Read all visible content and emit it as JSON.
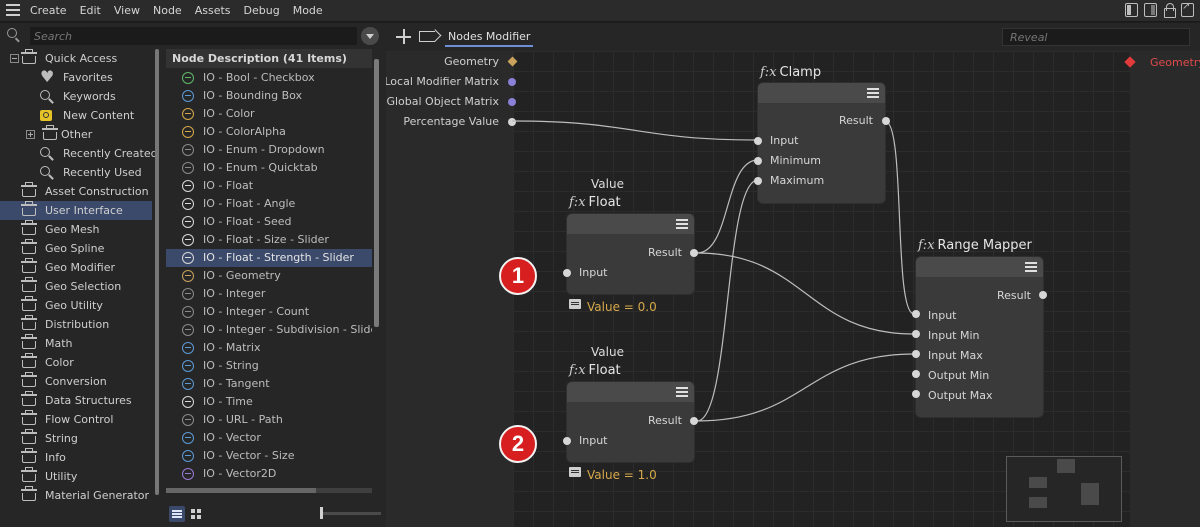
{
  "menubar": {
    "items": [
      "Create",
      "Edit",
      "View",
      "Node",
      "Assets",
      "Debug",
      "Mode"
    ]
  },
  "browser": {
    "search_placeholder": "Search",
    "tree": [
      {
        "label": "Quick Access",
        "icon": "drawer-icon",
        "expander": "minus"
      },
      {
        "label": "Favorites",
        "icon": "heart-icon"
      },
      {
        "label": "Keywords",
        "icon": "magnifier-icon"
      },
      {
        "label": "New Content",
        "icon": "new-content-icon"
      },
      {
        "label": "Other",
        "icon": "drawer-icon",
        "expander": "plus"
      },
      {
        "label": "Recently Created",
        "icon": "magnifier-icon"
      },
      {
        "label": "Recently Used",
        "icon": "magnifier-icon"
      },
      {
        "label": "Asset Construction",
        "icon": "drawer-icon"
      },
      {
        "label": "User Interface",
        "icon": "drawer-icon",
        "selected": true
      },
      {
        "label": "Geo Mesh",
        "icon": "drawer-icon"
      },
      {
        "label": "Geo Spline",
        "icon": "drawer-icon"
      },
      {
        "label": "Geo Modifier",
        "icon": "drawer-icon"
      },
      {
        "label": "Geo Selection",
        "icon": "drawer-icon"
      },
      {
        "label": "Geo Utility",
        "icon": "drawer-icon"
      },
      {
        "label": "Distribution",
        "icon": "drawer-icon"
      },
      {
        "label": "Math",
        "icon": "drawer-icon"
      },
      {
        "label": "Color",
        "icon": "drawer-icon"
      },
      {
        "label": "Conversion",
        "icon": "drawer-icon"
      },
      {
        "label": "Data Structures",
        "icon": "drawer-icon"
      },
      {
        "label": "Flow Control",
        "icon": "drawer-icon"
      },
      {
        "label": "String",
        "icon": "drawer-icon"
      },
      {
        "label": "Info",
        "icon": "drawer-icon"
      },
      {
        "label": "Utility",
        "icon": "drawer-icon"
      },
      {
        "label": "Material Generator",
        "icon": "drawer-icon"
      }
    ],
    "node_list_header": "Node Description (41 Items)",
    "node_list": [
      {
        "label": "IO - Bool - Checkbox",
        "color": "#5fb86a"
      },
      {
        "label": "IO - Bounding Box",
        "color": "#5b9bd5"
      },
      {
        "label": "IO - Color",
        "color": "#d6a84a"
      },
      {
        "label": "IO - ColorAlpha",
        "color": "#d6a84a"
      },
      {
        "label": "IO - Enum - Dropdown",
        "color": "#8a8a8a"
      },
      {
        "label": "IO - Enum - Quicktab",
        "color": "#8a8a8a"
      },
      {
        "label": "IO - Float",
        "color": "#d9d9d9"
      },
      {
        "label": "IO - Float - Angle",
        "color": "#d9d9d9"
      },
      {
        "label": "IO - Float - Seed",
        "color": "#d9d9d9"
      },
      {
        "label": "IO - Float - Size - Slider",
        "color": "#d9d9d9"
      },
      {
        "label": "IO - Float - Strength - Slider",
        "color": "#d9d9d9",
        "selected": true
      },
      {
        "label": "IO - Geometry",
        "color": "#c9a25d"
      },
      {
        "label": "IO - Integer",
        "color": "#8a8a8a"
      },
      {
        "label": "IO - Integer - Count",
        "color": "#8a8a8a"
      },
      {
        "label": "IO - Integer - Subdivision - Slider",
        "color": "#8a8a8a"
      },
      {
        "label": "IO - Matrix",
        "color": "#5b9bd5"
      },
      {
        "label": "IO - String",
        "color": "#5b9bd5"
      },
      {
        "label": "IO - Tangent",
        "color": "#5b9bd5"
      },
      {
        "label": "IO - Time",
        "color": "#d9d9d9"
      },
      {
        "label": "IO - URL - Path",
        "color": "#8a8a8a"
      },
      {
        "label": "IO - Vector",
        "color": "#5b9bd5"
      },
      {
        "label": "IO - Vector - Size",
        "color": "#5b9bd5"
      },
      {
        "label": "IO - Vector2D",
        "color": "#9a7bd6"
      }
    ]
  },
  "editor": {
    "tab_label": "Nodes Modifier",
    "reveal_placeholder": "Reveal",
    "inputs": [
      {
        "label": "Geometry",
        "port": "diamond"
      },
      {
        "label": "Local Modifier Matrix",
        "port": "purple"
      },
      {
        "label": "Global Object Matrix",
        "port": "purple"
      },
      {
        "label": "Percentage Value",
        "port": "white"
      }
    ],
    "output": {
      "label": "Geometry"
    },
    "nodes": {
      "clamp": {
        "fx": "f:x",
        "title": "Clamp",
        "output": "Result",
        "inputs": [
          "Input",
          "Minimum",
          "Maximum"
        ]
      },
      "float1": {
        "subtitle": "Value",
        "fx": "f:x",
        "title": "Float",
        "output": "Result",
        "inputs": [
          "Input"
        ],
        "note": "Value = 0.0",
        "badge": "1"
      },
      "float2": {
        "subtitle": "Value",
        "fx": "f:x",
        "title": "Float",
        "output": "Result",
        "inputs": [
          "Input"
        ],
        "note": "Value = 1.0",
        "badge": "2"
      },
      "range_mapper": {
        "fx": "f:x",
        "title": "Range Mapper",
        "output": "Result",
        "inputs": [
          "Input",
          "Input Min",
          "Input Max",
          "Output Min",
          "Output Max"
        ]
      }
    }
  }
}
